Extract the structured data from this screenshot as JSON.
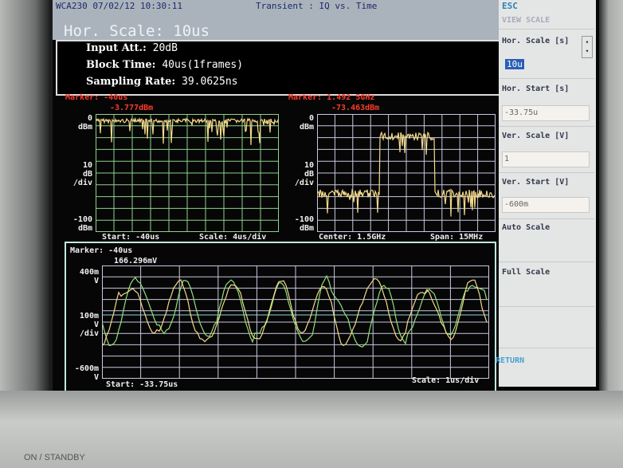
{
  "header": {
    "device": "WCA230 07/02/12 10:30:11",
    "mode": "Transient : IQ vs. Time",
    "title": "Hor. Scale: 10us"
  },
  "info": {
    "att_label": "Input Att.:",
    "att_value": "20dB",
    "block_label": "Block Time:",
    "block_value": "40us(1frames)",
    "rate_label": "Sampling Rate:",
    "rate_value": "39.0625ns"
  },
  "power_time": {
    "marker": "Marker: -40us",
    "marker_value": "-3.777dBm",
    "y_top": "0",
    "y_top_unit": "dBm",
    "y_scale": "10",
    "y_scale_unit": "dB",
    "y_scale_div": "/div",
    "y_bottom": "-100",
    "y_bottom_unit": "dBm",
    "start": "Start: -40us",
    "scale": "Scale: 4us/div"
  },
  "spectrum": {
    "marker": "Marker: 1.492 5GHz",
    "marker_value": "-73.463dBm",
    "y_top": "0",
    "y_top_unit": "dBm",
    "y_scale": "10",
    "y_scale_unit": "dB",
    "y_scale_div": "/div",
    "y_bottom": "-100",
    "y_bottom_unit": "dBm",
    "center": "Center: 1.5GHz",
    "span": "Span: 15MHz"
  },
  "iq": {
    "marker": "Marker: -40us",
    "marker_value": "166.296mV",
    "y_top": "400m",
    "y_top_unit": "V",
    "y_scale": "100m",
    "y_scale_unit": "V",
    "y_scale_div": "/div",
    "y_bottom": "-600m",
    "y_bottom_unit": "V",
    "start": "Start: -33.75us",
    "scale": "Scale: 1us/div"
  },
  "panel": {
    "esc": "ESC",
    "title": "VIEW SCALE",
    "hor_scale_label": "Hor. Scale [s]",
    "hor_scale_value": "10u",
    "hor_start_label": "Hor. Start [s]",
    "hor_start_value": "-33.75u",
    "ver_scale_label": "Ver. Scale [V]",
    "ver_scale_value": "1",
    "ver_start_label": "Ver. Start [V]",
    "ver_start_value": "-600m",
    "auto_scale": "Auto Scale",
    "full_scale": "Full Scale",
    "return": "RETURN"
  },
  "bezel": {
    "standby": "ON / STANDBY"
  },
  "colors": {
    "trace_i": "#f3d98a",
    "trace_q": "#8fe07a",
    "grid": "#c8c8e0",
    "marker": "#ff3a2a"
  }
}
